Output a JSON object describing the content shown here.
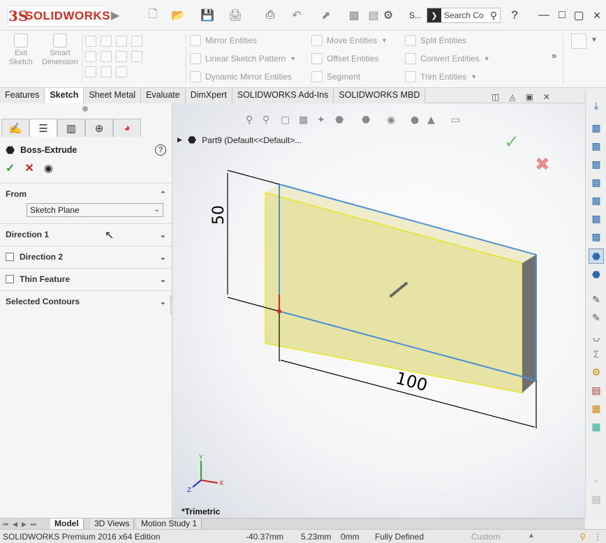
{
  "app": {
    "logo_text": "SOLIDWORKS",
    "search_placeholder": "Search Co",
    "title_short": "S..."
  },
  "command_manager": {
    "exit_sketch": "Exit Sketch",
    "smart_dimension": "Smart Dimension",
    "mirror_entities": "Mirror Entities",
    "linear_sketch_pattern": "Linear Sketch Pattern",
    "dynamic_mirror_entities": "Dynamic Mirror Entities",
    "move_entities": "Move Entities",
    "offset_entities": "Offset Entities",
    "segment": "Segment",
    "split_entities": "Split Entities",
    "convert_entities": "Convert Entities",
    "trim_entities": "Trim Entities"
  },
  "tabs": [
    "Features",
    "Sketch",
    "Sheet Metal",
    "Evaluate",
    "DimXpert",
    "SOLIDWORKS Add-Ins",
    "SOLIDWORKS MBD"
  ],
  "active_tab": "Sketch",
  "property_manager": {
    "title": "Boss-Extrude",
    "from_label": "From",
    "from_value": "Sketch Plane",
    "direction1": "Direction 1",
    "direction2": "Direction 2",
    "thin_feature": "Thin Feature",
    "selected_contours": "Selected Contours"
  },
  "graphics": {
    "tree_label": "Part9  (Default<<Default>...",
    "dim_height": "50",
    "dim_width": "100",
    "view_name": "*Trimetric",
    "triad": {
      "x": "X",
      "y": "Y",
      "z": "Z"
    }
  },
  "bottom_tabs": [
    "Model",
    "3D Views",
    "Motion Study 1"
  ],
  "status_bar": {
    "edition": "SOLIDWORKS Premium 2016 x64 Edition",
    "x": "-40.37mm",
    "y": "5.23mm",
    "z": "0mm",
    "sketch_state": "Fully Defined",
    "units": "Custom"
  },
  "colors": {
    "brand": "#d52b1e",
    "extrude_fill": "#e6e3a4",
    "sketch_edge": "#4a90d9",
    "confirm_green": "#2e9b3a",
    "cancel_red": "#c62828"
  }
}
